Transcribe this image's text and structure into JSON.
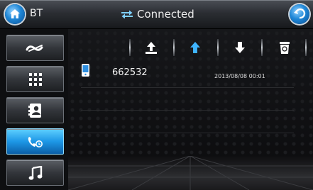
{
  "header": {
    "title": "BT",
    "status": "Connected"
  },
  "sidebar": {
    "items": [
      {
        "icon": "link-icon",
        "active": false
      },
      {
        "icon": "dialpad-icon",
        "active": false
      },
      {
        "icon": "contacts-icon",
        "active": false
      },
      {
        "icon": "call-log-icon",
        "active": true
      },
      {
        "icon": "music-icon",
        "active": false
      }
    ]
  },
  "toolbar": {
    "buttons": [
      "upload-icon",
      "up-arrow-icon",
      "down-arrow-icon",
      "trash-icon"
    ]
  },
  "call_log": {
    "entries": [
      {
        "number": "662532",
        "datetime": "2013/08/08 00:01",
        "icon": "phone-icon"
      }
    ]
  },
  "colors": {
    "accent": "#1d97e6",
    "accent_light": "#5fd0ff",
    "text": "#f2f2f2"
  }
}
